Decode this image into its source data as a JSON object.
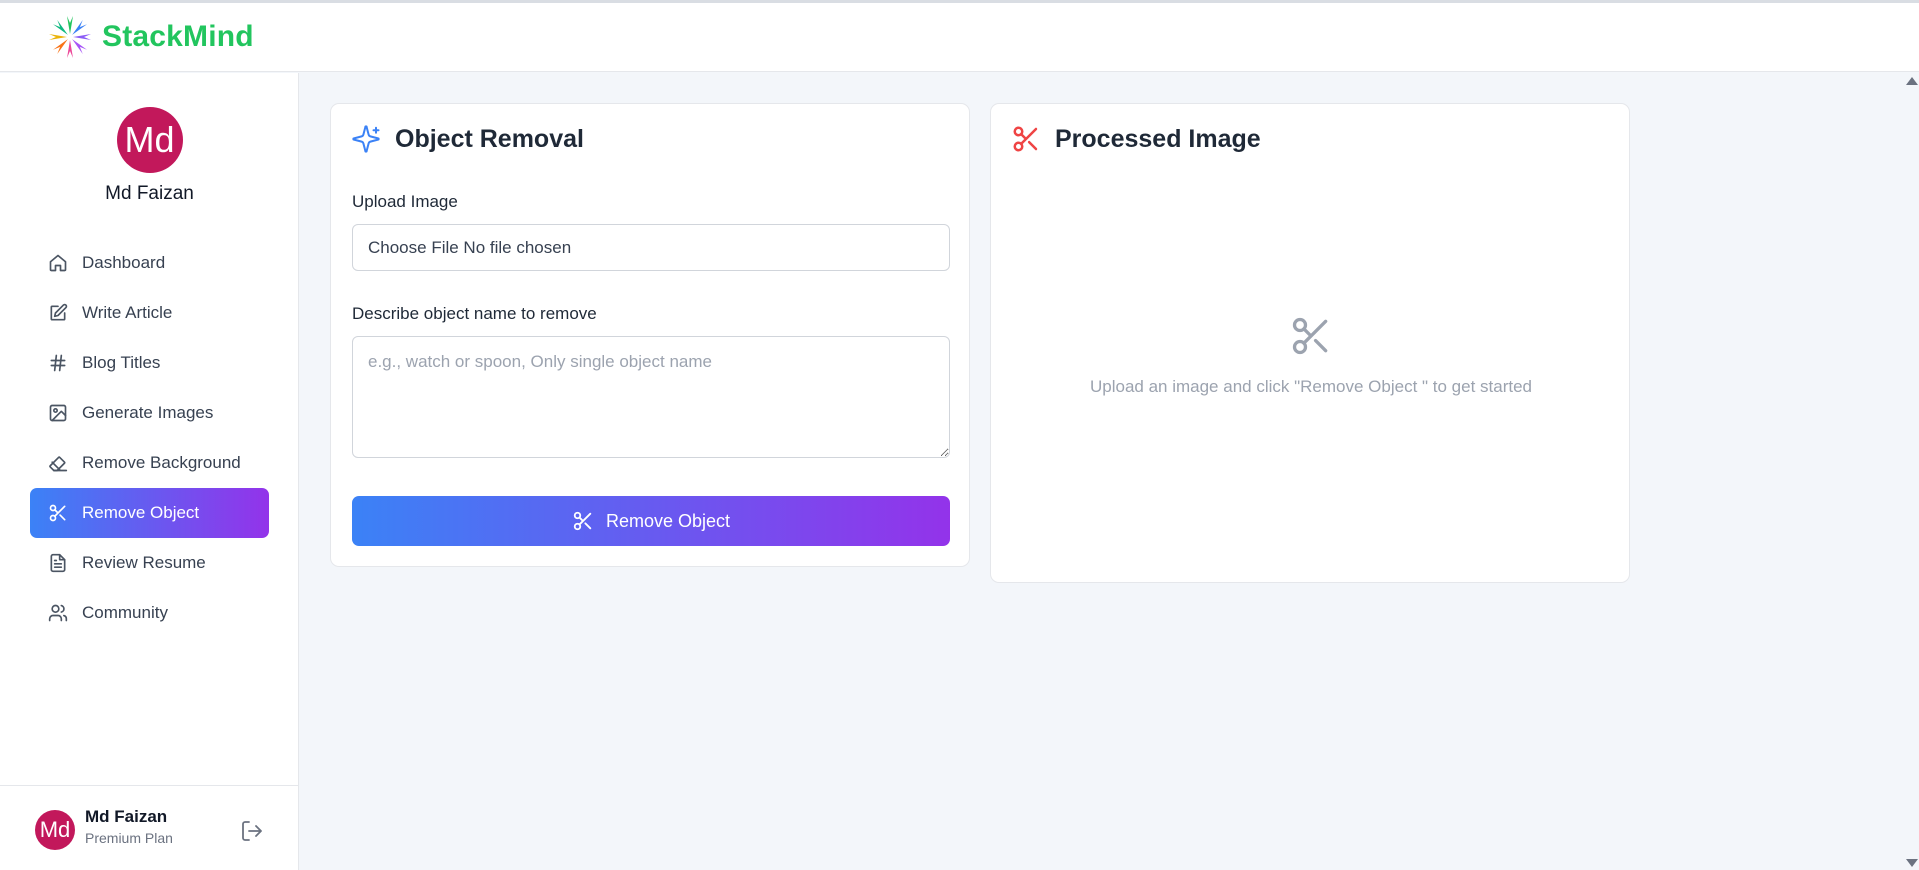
{
  "brand": {
    "name": "StackMind",
    "color": "#22c55e",
    "logo_icon": "star-burst-logo"
  },
  "sidebar": {
    "profile": {
      "initials": "Md",
      "name": "Md Faizan",
      "avatar_color": "#c2185b"
    },
    "items": [
      {
        "label": "Dashboard",
        "icon": "home-icon",
        "active": false
      },
      {
        "label": "Write Article",
        "icon": "edit-square-icon",
        "active": false
      },
      {
        "label": "Blog Titles",
        "icon": "hash-icon",
        "active": false
      },
      {
        "label": "Generate Images",
        "icon": "image-icon",
        "active": false
      },
      {
        "label": "Remove Background",
        "icon": "eraser-icon",
        "active": false
      },
      {
        "label": "Remove Object",
        "icon": "scissors-icon",
        "active": true
      },
      {
        "label": "Review Resume",
        "icon": "file-text-icon",
        "active": false
      },
      {
        "label": "Community",
        "icon": "users-icon",
        "active": false
      }
    ],
    "footer": {
      "initials": "Md",
      "name": "Md Faizan",
      "plan": "Premium Plan",
      "logout_icon": "logout-icon"
    }
  },
  "object_removal": {
    "title": "Object Removal",
    "title_icon": "sparkles-icon",
    "upload_label": "Upload Image",
    "file_input_text": "Choose File No file chosen",
    "describe_label": "Describe object name to remove",
    "describe_value": "",
    "describe_placeholder": "e.g., watch or spoon, Only single object name",
    "button_label": "Remove Object",
    "button_icon": "scissors-icon"
  },
  "processed_image": {
    "title": "Processed Image",
    "title_icon": "scissors-icon",
    "title_icon_color": "#ef4444",
    "empty_icon": "scissors-icon",
    "empty_text": "Upload an image and click \"Remove Object \" to get started"
  },
  "theme": {
    "accent_gradient_start": "#3b82f6",
    "accent_gradient_end": "#9333ea",
    "page_background": "#f3f6fa"
  }
}
